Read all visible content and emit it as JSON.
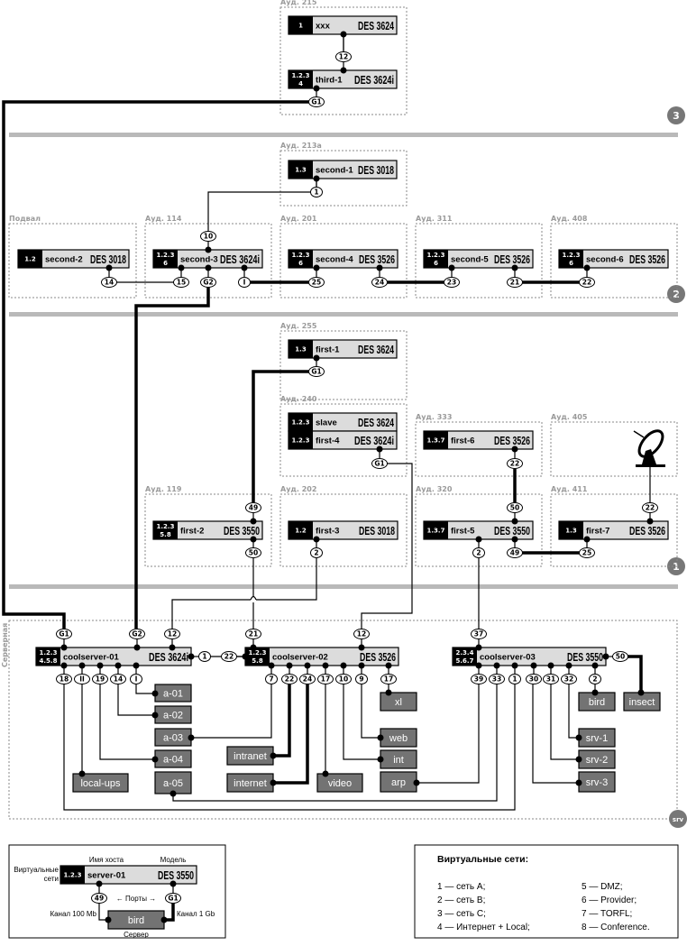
{
  "floors": [
    "3",
    "2",
    "1"
  ],
  "server_room": {
    "label": "Серверная",
    "marker": "srv"
  },
  "rooms": [
    "Ауд. 215",
    "Ауд. 213а",
    "Подвал",
    "Ауд. 114",
    "Ауд. 201",
    "Ауд. 311",
    "Ауд. 408",
    "Ауд. 255",
    "Ауд. 240",
    "Ауд. 333",
    "Ауд. 405",
    "Ауд. 119",
    "Ауд. 202",
    "Ауд. 320",
    "Ауд. 411"
  ],
  "switches": [
    {
      "vlans": [
        "1"
      ],
      "host": "xxx",
      "model": "DES 3624"
    },
    {
      "vlans": [
        "1.2.3",
        "4"
      ],
      "host": "third-1",
      "model": "DES 3624i"
    },
    {
      "vlans": [
        "1.3"
      ],
      "host": "second-1",
      "model": "DES 3018"
    },
    {
      "vlans": [
        "1.2"
      ],
      "host": "second-2",
      "model": "DES 3018"
    },
    {
      "vlans": [
        "1.2.3",
        "6"
      ],
      "host": "second-3",
      "model": "DES 3624i"
    },
    {
      "vlans": [
        "1.2.3",
        "6"
      ],
      "host": "second-4",
      "model": "DES 3526"
    },
    {
      "vlans": [
        "1.2.3",
        "6"
      ],
      "host": "second-5",
      "model": "DES 3526"
    },
    {
      "vlans": [
        "1.2.3",
        "6"
      ],
      "host": "second-6",
      "model": "DES 3526"
    },
    {
      "vlans": [
        "1.3"
      ],
      "host": "first-1",
      "model": "DES 3624"
    },
    {
      "vlans": [
        "1.2.3"
      ],
      "host": "slave",
      "model": "DES 3624"
    },
    {
      "vlans": [
        "1.2.3"
      ],
      "host": "first-4",
      "model": "DES 3624i"
    },
    {
      "vlans": [
        "1.3.7"
      ],
      "host": "first-6",
      "model": "DES 3526"
    },
    {
      "vlans": [
        "1.2.3",
        "5.8"
      ],
      "host": "first-2",
      "model": "DES 3550"
    },
    {
      "vlans": [
        "1.2"
      ],
      "host": "first-3",
      "model": "DES 3018"
    },
    {
      "vlans": [
        "1.3.7"
      ],
      "host": "first-5",
      "model": "DES 3550"
    },
    {
      "vlans": [
        "1.3"
      ],
      "host": "first-7",
      "model": "DES 3526"
    },
    {
      "vlans": [
        "1.2.3",
        "4.5.8"
      ],
      "host": "coolserver-01",
      "model": "DES 3624i"
    },
    {
      "vlans": [
        "1.2.3",
        "5.8"
      ],
      "host": "coolserver-02",
      "model": "DES 3526"
    },
    {
      "vlans": [
        "2.3.4",
        "5.6.7"
      ],
      "host": "coolserver-03",
      "model": "DES 3550"
    }
  ],
  "ports": [
    "12",
    "G1",
    "1",
    "10",
    "14",
    "15",
    "G2",
    "I",
    "25",
    "24",
    "23",
    "21",
    "22",
    "G1",
    "G1",
    "22",
    "49",
    "50",
    "2",
    "50",
    "2",
    "49",
    "22",
    "25",
    "G1",
    "G2",
    "12",
    "21",
    "12",
    "37",
    "18",
    "II",
    "19",
    "14",
    "I",
    "7",
    "22",
    "24",
    "17",
    "10",
    "9",
    "17",
    "39",
    "33",
    "1",
    "30",
    "31",
    "32",
    "2",
    "1",
    "22",
    "50"
  ],
  "servers": [
    "a-01",
    "a-02",
    "a-03",
    "a-04",
    "a-05",
    "local-ups",
    "intranet",
    "internet",
    "video",
    "web",
    "int",
    "arp",
    "xl",
    "bird",
    "insect",
    "srv-1",
    "srv-2",
    "srv-3"
  ],
  "icons": {
    "satellite": "satellite-dish-icon"
  },
  "legend": {
    "switch": {
      "vlans": [
        "1.2.3"
      ],
      "host": "server-01",
      "model": "DES 3550"
    },
    "host_caption": "Имя хоста",
    "model_caption": "Модель",
    "vlan_caption": [
      "Виртуальные",
      "сети"
    ],
    "ports_caption": "← Порты →",
    "port_a": "49",
    "port_b": "G1",
    "channel_100": "Канал 100 Mb",
    "channel_1g": "Канал 1 Gb",
    "server": "bird",
    "server_caption": "Сервер"
  },
  "vlan_legend": {
    "title": "Виртуальные сети:",
    "items": [
      "1 — сеть A;",
      "2 — сеть B;",
      "3 — сеть C;",
      "4 — Интернет + Local;",
      "5 — DMZ;",
      "6 — Provider;",
      "7 — TORFL;",
      "8 — Conference."
    ]
  },
  "colors": {
    "switch_body": "#dcdcdc",
    "vlan_block": "#000000",
    "server_box": "#737373",
    "floor_bar": "#b9b9b9",
    "room_label": "#9a9a9a"
  }
}
